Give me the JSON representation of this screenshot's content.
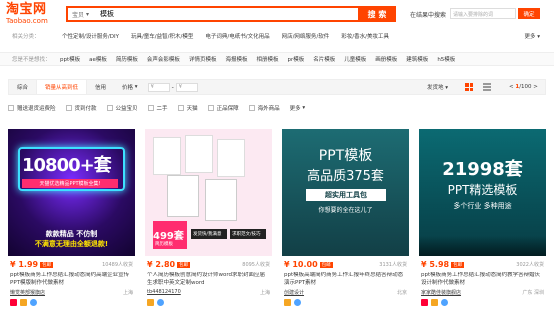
{
  "header": {
    "logo_zh": "淘宝网",
    "logo_en": "Taobao.com",
    "search_category": "宝贝",
    "search_query": "模板",
    "search_button": "搜 索",
    "within_label": "在结果中搜索",
    "within_placeholder": "请输入要排除的词",
    "within_button": "确定"
  },
  "related": {
    "label": "相关分类：",
    "items": [
      "个性定制/设计服务/DIY",
      "玩具/童车/益智/积木/模型",
      "电子词典/电纸书/文化用品",
      "网店/网络服务/软件",
      "彩妆/香水/美妆工具"
    ],
    "more": "更多"
  },
  "you_want": {
    "label": "您是不是想找：",
    "items": [
      "ppt模板",
      "ae模板",
      "简历模板",
      "会声会影模板",
      "详情页模板",
      "海报模板",
      "相册模板",
      "pr模板",
      "名片模板",
      "儿童模板",
      "画册模板",
      "建筑模板",
      "h5模板"
    ]
  },
  "sortbar": {
    "sorts": [
      "综合",
      "销量从高到低",
      "信用",
      "价格"
    ],
    "active_index": 1,
    "price_from": "¥",
    "price_to": "¥",
    "ship_to": "发货地",
    "page_current": "1",
    "page_total": "/100"
  },
  "filters": [
    "赠送退货运费险",
    "货到付款",
    "公益宝贝",
    "二手",
    "天猫",
    "正品保障",
    "海外商品"
  ],
  "filters_more": "更多",
  "products": [
    {
      "art_big": "10800+套",
      "art_sub": "天猫优选精品PPT模板全集!",
      "art_bottom1": "款款精品 不仿制",
      "art_bottom2": "不满意无理由全额退款!",
      "price": "¥ 1.99",
      "tag": "包邮",
      "sold": "10489人收货",
      "title": "ppt模板商务工作总结汇报动态简约高端企业宣传PPT模版制作代做素材",
      "shop": "懒觉英部猴旗店",
      "location": "上海"
    },
    {
      "art_big": "499套",
      "art_sub": "简历模板",
      "art_badge1": "发货快/我满意",
      "art_badge2": "求职范文/技巧",
      "price": "¥ 2.80",
      "tag": "包邮",
      "sold": "8095人收货",
      "title": "个人简历模板创意简约设计师word求职封面应届生求职中英文定制word",
      "shop": "tb448124170",
      "location": "上海"
    },
    {
      "art_line1": "PPT模板",
      "art_line2": "高品质375套",
      "art_line3": "超实用工具包",
      "art_line4": "你想要的全在这儿了",
      "price": "¥ 10.00",
      "tag": "包邮",
      "sold": "3131人收货",
      "title": "ppt模板高端简约商务工作汇报年终总结答辩动态演示PPT素材",
      "shop": "创建设计",
      "location": "北京"
    },
    {
      "art_big": "21998套",
      "art_line1": "PPT精选模板",
      "art_line2": "多个行业 多种用途",
      "price": "¥ 5.98",
      "tag": "包邮",
      "sold": "3022人收货",
      "title": "ppt模板商务工作总结汇报动态简约教学答辩婚庆设计制作代做素材",
      "shop": "家家酷佳装旗舰店",
      "location": "广东 深圳"
    }
  ],
  "colors": {
    "accent": "#ff4400"
  }
}
